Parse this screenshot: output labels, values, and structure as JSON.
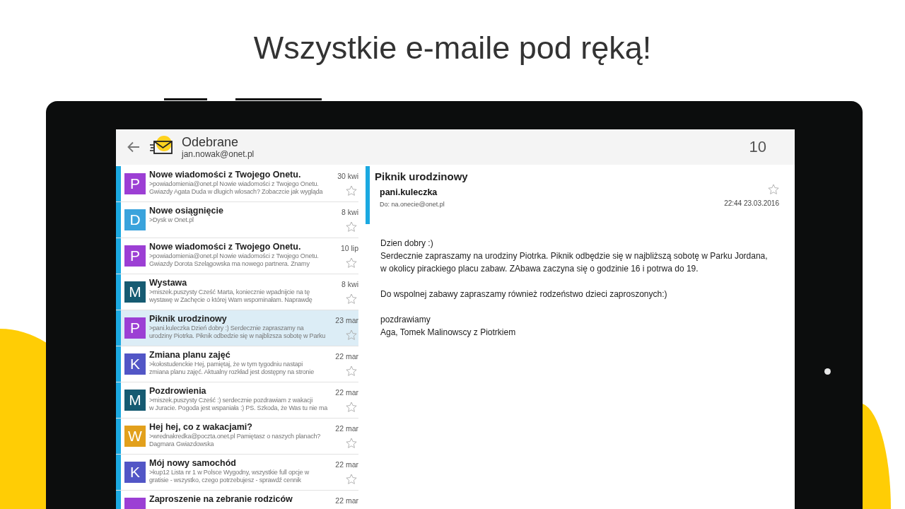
{
  "headline": "Wszystkie e-maile pod ręką!",
  "app_bar": {
    "title": "Odebrane",
    "account": "jan.nowak@onet.pl",
    "count": "10"
  },
  "messages": [
    {
      "avatar": "P",
      "color": "#9c3fd4",
      "title": "Nowe wiadomości z Twojego Onetu.",
      "preview_lines": [
        ">powiadomienia@onet.pl Nowie wiadomości z Twojego Onetu.",
        "Gwiazdy Agata Duda w dlugich wlosach? Zobaczcie jak wygląda"
      ],
      "date": "30 kwi",
      "unread": true,
      "starred": false,
      "selected": false
    },
    {
      "avatar": "D",
      "color": "#3aa3dc",
      "title": "Nowe osiągnięcie",
      "preview_lines": [
        ">Dysk w Onet.pl"
      ],
      "date": "8 kwi",
      "unread": true,
      "starred": false,
      "selected": false
    },
    {
      "avatar": "P",
      "color": "#9c3fd4",
      "title": "Nowe wiadomości z Twojego Onetu.",
      "preview_lines": [
        ">powiadomienia@onet.pl Nowie wiadomości z Twojego Onetu.",
        "Gwiazdy Dorota Szelągowska ma nowego partnera. Znamy"
      ],
      "date": "10 lip",
      "unread": true,
      "starred": false,
      "selected": false
    },
    {
      "avatar": "M",
      "color": "#165b72",
      "title": "Wystawa",
      "preview_lines": [
        ">miszek.puszysty Cześć Marta, koniecznie wpadnijcie na tę",
        "wystawę w Zachęcie o której Wam wspominałam. Naprawdę"
      ],
      "date": "8 kwi",
      "unread": true,
      "starred": false,
      "selected": false
    },
    {
      "avatar": "P",
      "color": "#9c3fd4",
      "title": "Piknik urodzinowy",
      "preview_lines": [
        ">pani.kuleczka  Dzień dobry :) Serdecznie zapraszamy na",
        "urodziny Piotrka. Piknik odbedzie się w najblizsza sobotę w Parku"
      ],
      "date": "23 mar",
      "unread": true,
      "starred": false,
      "selected": true
    },
    {
      "avatar": "K",
      "color": "#5256c6",
      "title": "Zmiana planu zajęć",
      "preview_lines": [
        ">kołostudenckie  Hej, pamiętaj, że w tym tygodniu nastapi",
        "zmiana planu zajęć. Aktualny rozkład jest dostępny na stronie"
      ],
      "date": "22 mar",
      "unread": true,
      "starred": false,
      "selected": false
    },
    {
      "avatar": "M",
      "color": "#165b72",
      "title": "Pozdrowienia",
      "preview_lines": [
        ">miszek.puszysty Cześć :) serdecznie pozdrawiam z wakacji",
        "w Juracie. Pogoda jest wspaniała :) PS. Szkoda, że Was tu nie ma"
      ],
      "date": "22 mar",
      "unread": true,
      "starred": false,
      "selected": false
    },
    {
      "avatar": "W",
      "color": "#e2a01c",
      "title": "Hej hej, co z wakacjami?",
      "preview_lines": [
        ">wrednakredka@poczta.onet.pl  Pamiętasz o naszych planach?",
        "Dagmara Gwiazdowska"
      ],
      "date": "22 mar",
      "unread": true,
      "starred": false,
      "selected": false
    },
    {
      "avatar": "K",
      "color": "#5256c6",
      "title": "Mój nowy samochód",
      "preview_lines": [
        ">kup12 Lista nr 1 w Polsce  Wygodny, wszystkie full opcje w",
        "gratisie - wszystko, czego potrzebujesz - sprawdź cennik"
      ],
      "date": "22 mar",
      "unread": true,
      "starred": false,
      "selected": false
    },
    {
      "color": "#9c3fd4",
      "title": "Zaproszenie na zebranie rodziców",
      "date": "22 mar",
      "unread": true,
      "selected": false
    }
  ],
  "reader": {
    "subject": "Piknik urodzinowy",
    "sender": "pani.kuleczka",
    "to": "Do: na.onecie@onet.pl",
    "starred": false,
    "timestamp": "22:44  23.03.2016",
    "body": [
      [
        "Dzien dobry :)",
        "Serdecznie zapraszamy na urodziny Piotrka. Piknik odbędzie się w najbliższą sobotę w Parku Jordana, w okolicy pirackiego placu zabaw. ZAbawa zaczyna się o godzinie 16 i potrwa do 19."
      ],
      [
        "Do wspolnej zabawy zapraszamy również rodzeństwo dzieci zaproszonych:)"
      ],
      [
        "pozdrawiamy",
        "Aga, Tomek Malinowscy z Piotrkiem"
      ]
    ]
  }
}
